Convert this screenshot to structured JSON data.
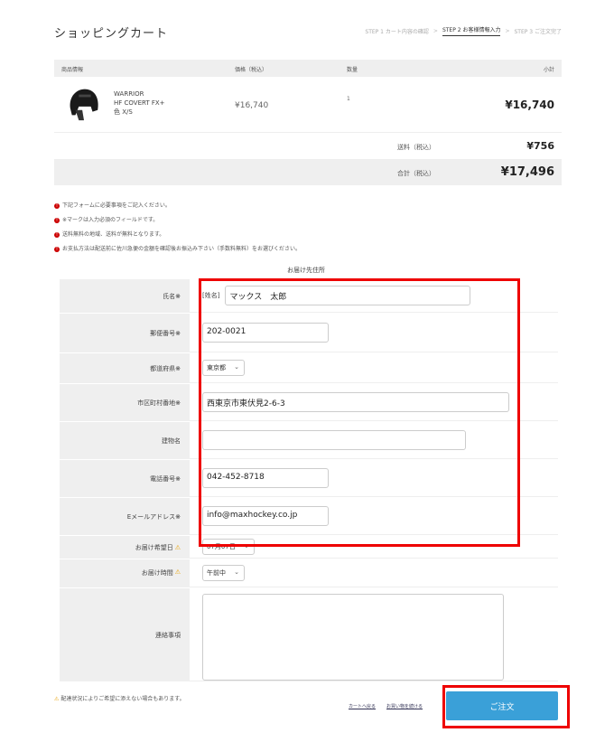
{
  "page": {
    "title": "ショッピングカート"
  },
  "steps": [
    {
      "label": "STEP 1 カート内容の確認"
    },
    {
      "label": "STEP 2 お客様情報入力"
    },
    {
      "label": "STEP 3 ご注文完了"
    }
  ],
  "cart": {
    "headers": {
      "item": "商品情報",
      "price": "価格（税込）",
      "qty": "数量",
      "subtotal": "小計"
    },
    "item": {
      "brand": "WARRIOR",
      "name": "HF COVERT FX+",
      "variant": "色 X/S",
      "price": "¥16,740",
      "qty": "1",
      "subtotal": "¥16,740"
    },
    "shipping": {
      "label": "送料（税込）",
      "value": "¥756"
    },
    "total": {
      "label": "合計（税込）",
      "value": "¥17,496"
    }
  },
  "notes": [
    "下記フォームに必要事項をご記入ください。",
    "※マークは入力必須のフィールドです。",
    "送料無料の地域、送料が無料となります。",
    "お支払方法は配送前に佐川急便の金額を確認後お振込み下さい（手数料無料）をお選びください。"
  ],
  "form": {
    "section_title": "お届け先住所",
    "name": {
      "label": "氏名",
      "tag": "[姓名]",
      "value": "マックス　太郎"
    },
    "zip": {
      "label": "郵便番号",
      "value": "202-0021"
    },
    "pref": {
      "label": "都道府県",
      "value": "東京都"
    },
    "address": {
      "label": "市区町村番地",
      "value": "西東京市東伏見2-6-3"
    },
    "building": {
      "label": "建物名",
      "value": ""
    },
    "phone": {
      "label": "電話番号",
      "value": "042-452-8718"
    },
    "email": {
      "label": "Eメールアドレス",
      "value": "info@maxhockey.co.jp"
    },
    "delivery_date": {
      "label": "お届け希望日",
      "value": "07月07日"
    },
    "delivery_time": {
      "label": "お届け時間",
      "value": "午前中"
    },
    "remarks": {
      "label": "連絡事項",
      "value": ""
    },
    "required_mark": "※",
    "warn_mark": "⚠"
  },
  "bottom": {
    "note": "配達状況によりご希望に添えない場合もあります。",
    "back_link": "カートへ戻る",
    "continue_link": "お買い物を続ける",
    "order_button": "ご注文"
  },
  "colors": {
    "accent": "#3aa0d8",
    "highlight": "#e00000",
    "warning": "#e8a000"
  }
}
